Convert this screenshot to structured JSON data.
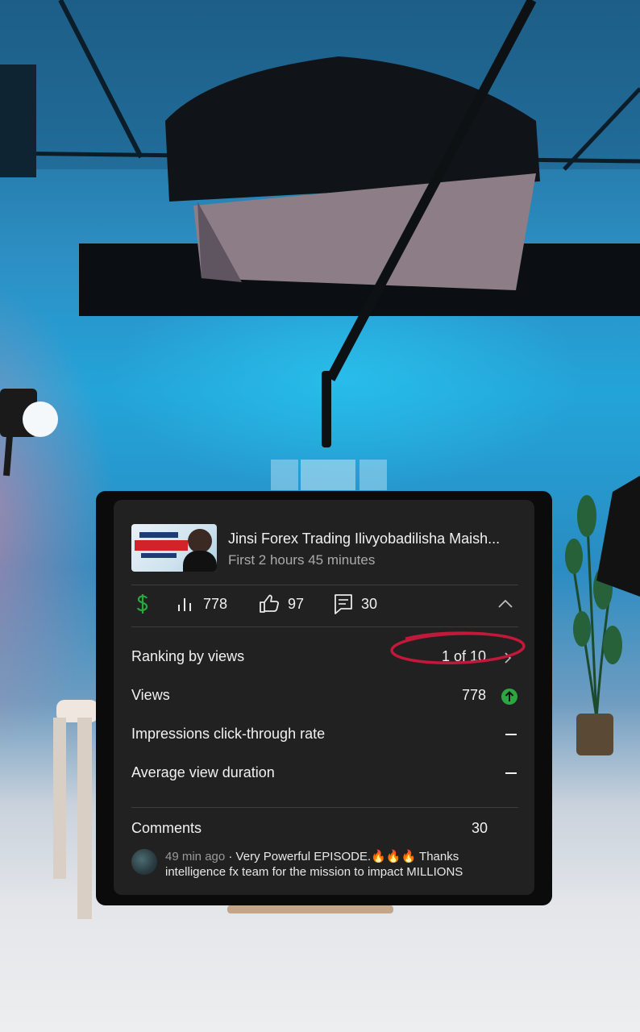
{
  "video": {
    "title": "Jinsi Forex Trading Ilivyobadilisha Maish...",
    "subtitle": "First 2 hours 45 minutes",
    "thumbnail_text": "MULTI-BILLION DOLLAR"
  },
  "stats": {
    "views": "778",
    "likes": "97",
    "comments": "30"
  },
  "metrics": [
    {
      "label": "Ranking by views",
      "value": "1 of 10"
    },
    {
      "label": "Views",
      "value": "778"
    },
    {
      "label": "Impressions click-through rate",
      "value": "—"
    },
    {
      "label": "Average view duration",
      "value": "—"
    }
  ],
  "comments_section": {
    "label": "Comments",
    "count": "30",
    "latest": {
      "time": "49 min ago",
      "text": "· Very Powerful EPISODE.🔥🔥🔥 Thanks intelligence fx team for the mission to impact MILLIONS"
    }
  },
  "colors": {
    "accent_green": "#2ba640",
    "highlight_circle": "#c2183a",
    "card_bg": "#212121"
  }
}
